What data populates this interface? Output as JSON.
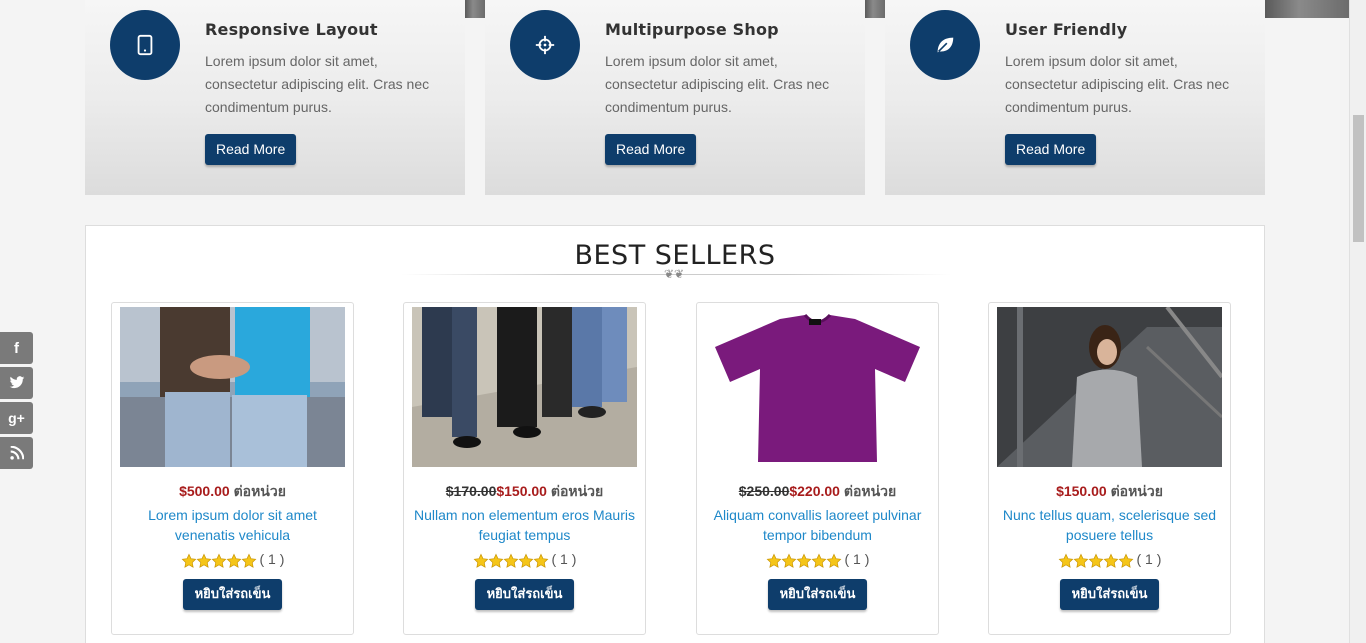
{
  "features": [
    {
      "title": "Responsive Layout",
      "text": "Lorem ipsum dolor sit amet, consectetur adipiscing elit. Cras nec condimentum purus.",
      "button": "Read More",
      "icon": "tablet-icon"
    },
    {
      "title": "Multipurpose Shop",
      "text": "Lorem ipsum dolor sit amet, consectetur adipiscing elit. Cras nec condimentum purus.",
      "button": "Read More",
      "icon": "crosshair-icon"
    },
    {
      "title": "User Friendly",
      "text": "Lorem ipsum dolor sit amet, consectetur adipiscing elit. Cras nec condimentum purus.",
      "button": "Read More",
      "icon": "leaf-icon"
    }
  ],
  "best_sellers": {
    "heading": "BEST SELLERS",
    "products": [
      {
        "old_price": "",
        "price": "$500.00",
        "unit": "ต่อหน่วย",
        "title": "Lorem ipsum dolor sit amet venenatis vehicula",
        "rating_count": "( 1 )",
        "cart_label": "หยิบใส่รถเข็น",
        "image": "couple-jeans-photo"
      },
      {
        "old_price": "$170.00",
        "price": "$150.00",
        "unit": "ต่อหน่วย",
        "title": "Nullam non elementum eros Mauris feugiat tempus",
        "rating_count": "( 1 )",
        "cart_label": "หยิบใส่รถเข็น",
        "image": "people-walking-photo"
      },
      {
        "old_price": "$250.00",
        "price": "$220.00",
        "unit": "ต่อหน่วย",
        "title": "Aliquam convallis laoreet pulvinar tempor bibendum",
        "rating_count": "( 1 )",
        "cart_label": "หยิบใส่รถเข็น",
        "image": "purple-tshirt-photo"
      },
      {
        "old_price": "",
        "price": "$150.00",
        "unit": "ต่อหน่วย",
        "title": "Nunc tellus quam, scelerisque sed posuere tellus",
        "rating_count": "( 1 )",
        "cart_label": "หยิบใส่รถเข็น",
        "image": "woman-stairs-photo"
      }
    ]
  },
  "social": [
    "facebook-icon",
    "twitter-icon",
    "google-plus-icon",
    "rss-icon"
  ],
  "colors": {
    "brand": "#0e3d6b",
    "price": "#a81c1c",
    "link": "#1e88c9"
  }
}
